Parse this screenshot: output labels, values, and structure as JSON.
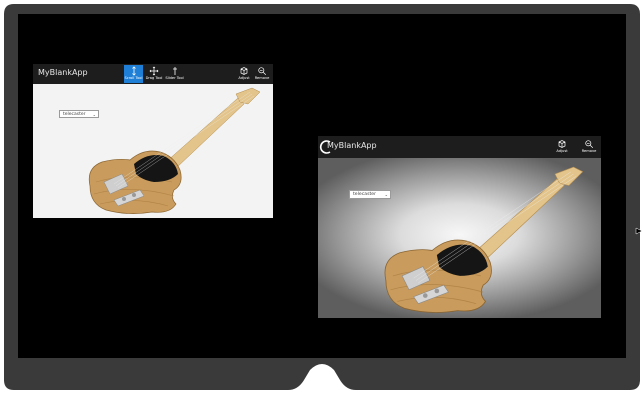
{
  "window1": {
    "title": "MyBlankApp",
    "tools": [
      {
        "label": "Scroll Tool",
        "icon": "scroll-icon",
        "active": true
      },
      {
        "label": "Drag Tool",
        "icon": "drag-icon",
        "active": false
      },
      {
        "label": "Slider Tool",
        "icon": "slider-icon",
        "active": false
      }
    ],
    "actions": [
      {
        "label": "Adjust",
        "icon": "adjust-icon"
      },
      {
        "label": "Remove",
        "icon": "remove-icon"
      }
    ],
    "dropdown_value": "telecaster"
  },
  "window2": {
    "title": "MyBlankApp",
    "actions": [
      {
        "label": "Adjust",
        "icon": "adjust-icon"
      },
      {
        "label": "Remove",
        "icon": "remove-icon"
      }
    ],
    "dropdown_value": "telecaster"
  },
  "colors": {
    "frame": "#3a3a3a",
    "frame_inner": "#000000",
    "titlebar": "#1d1d1d",
    "active_tool": "#1f7fd6"
  }
}
